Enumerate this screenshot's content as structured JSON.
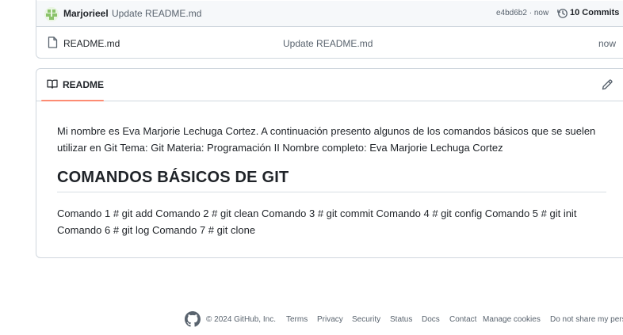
{
  "latest_commit": {
    "author": "Marjorieel",
    "message": "Update README.md",
    "sha_age": "e4bd6b2 · now",
    "history_label": "10 Commits"
  },
  "files": [
    {
      "name": "README.md",
      "message": "Update README.md",
      "age": "now"
    }
  ],
  "readme": {
    "tab_label": "README",
    "intro": "Mi nombre es Eva Marjorie Lechuga Cortez. A continuación presento algunos de los comandos básicos que se suelen utilizar en Git Tema: Git Materia: Programación II Nombre completo: Eva Marjorie Lechuga Cortez",
    "heading": "COMANDOS BÁSICOS DE GIT",
    "commands": "Comando 1 # git add Comando 2 # git clean Comando 3 # git commit Comando 4 # git config Comando 5 # git init Comando 6 # git log Comando 7 # git clone"
  },
  "footer": {
    "copyright": "© 2024 GitHub, Inc.",
    "links": [
      "Terms",
      "Privacy",
      "Security",
      "Status",
      "Docs",
      "Contact",
      "Manage cookies",
      "Do not share my personal information"
    ]
  },
  "icons": {
    "avatar": "avatar-icon",
    "history": "history-icon",
    "file": "file-icon",
    "book": "book-icon",
    "edit": "pencil-icon",
    "logo": "github-logo-icon"
  }
}
